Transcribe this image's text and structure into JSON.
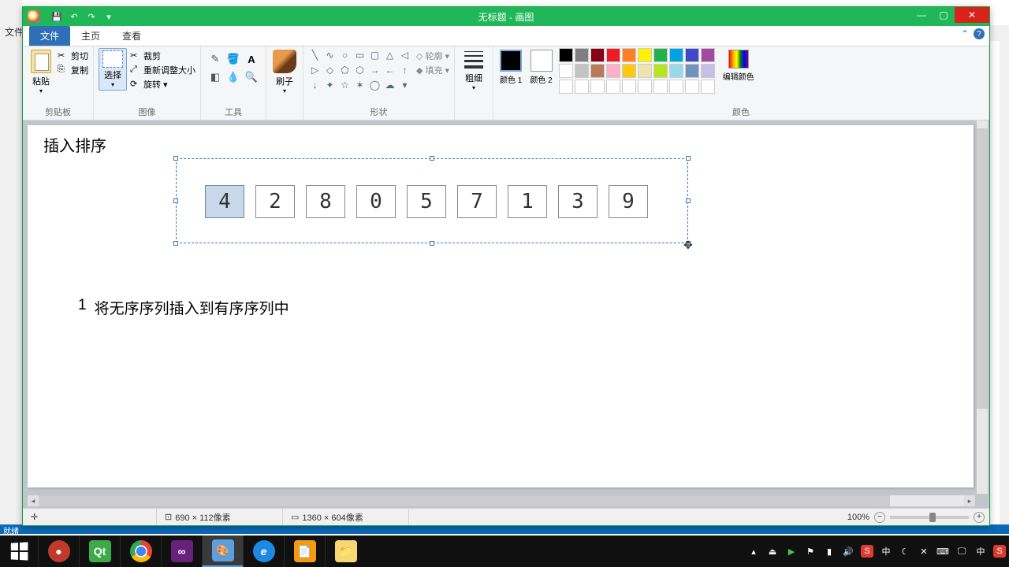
{
  "bg_menu": "文件",
  "titlebar": {
    "title": "无标题 - 画图"
  },
  "qat": {
    "save": "💾",
    "undo": "↶",
    "redo": "↷"
  },
  "tabs": {
    "file": "文件",
    "home": "主页",
    "view": "查看"
  },
  "ribbon": {
    "clipboard": {
      "paste": "粘贴",
      "cut": "剪切",
      "copy": "复制",
      "label": "剪贴板"
    },
    "image": {
      "select": "选择",
      "crop": "裁剪",
      "resize": "重新调整大小",
      "rotate": "旋转",
      "label": "图像"
    },
    "tools": {
      "label": "工具"
    },
    "brush": {
      "label": "刷子"
    },
    "shapes": {
      "outline": "轮廓",
      "fill": "填充",
      "label": "形状"
    },
    "size": {
      "label": "粗细"
    },
    "colors": {
      "c1": "颜色 1",
      "c2": "颜色 2",
      "edit": "编辑颜色",
      "label": "颜色"
    }
  },
  "palette_row1": [
    "#000000",
    "#7f7f7f",
    "#880015",
    "#ed1c24",
    "#ff7f27",
    "#fff200",
    "#22b14c",
    "#00a2e8",
    "#3f48cc",
    "#a349a4"
  ],
  "palette_row2": [
    "#ffffff",
    "#c3c3c3",
    "#b97a57",
    "#ffaec9",
    "#ffc90e",
    "#efe4b0",
    "#b5e61d",
    "#99d9ea",
    "#7092be",
    "#c8bfe7"
  ],
  "canvas": {
    "title_text": "插入排序",
    "boxes": [
      "4",
      "2",
      "8",
      "0",
      "5",
      "7",
      "1",
      "3",
      "9"
    ],
    "highlighted_index": 0,
    "step_num": "1",
    "step_text": "将无序序列插入到有序序列中"
  },
  "statusbar": {
    "cursor_icon": "✛",
    "selection_size": "690 × 112像素",
    "canvas_size": "1360 × 604像素",
    "zoom": "100%"
  },
  "desk_status": "就绪",
  "tray": {
    "ime_s": "S",
    "ime_zh": "中"
  }
}
